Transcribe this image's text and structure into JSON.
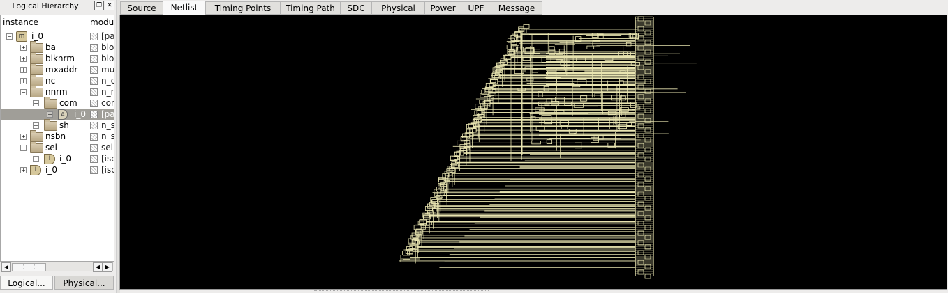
{
  "left_panel": {
    "title": "Logical Hierarchy",
    "float_icon": "restore-icon",
    "close_icon": "close-icon",
    "columns": [
      "instance",
      "modu"
    ],
    "tree": [
      {
        "label": "i_0",
        "module": "[pa",
        "icon": "module-icon",
        "expander": "−",
        "level": 0
      },
      {
        "label": "ba",
        "module": "blo",
        "icon": "folder-icon",
        "expander": "+",
        "level": 1
      },
      {
        "label": "blknrm",
        "module": "blo",
        "icon": "folder-icon",
        "expander": "+",
        "level": 1
      },
      {
        "label": "mxaddr",
        "module": "mu",
        "icon": "folder-icon",
        "expander": "+",
        "level": 1
      },
      {
        "label": "nc",
        "module": "n_c",
        "icon": "folder-icon",
        "expander": "+",
        "level": 1
      },
      {
        "label": "nnrm",
        "module": "n_r",
        "icon": "folder-icon",
        "expander": "−",
        "level": 1
      },
      {
        "label": "com",
        "module": "cor",
        "icon": "folder-icon",
        "expander": "−",
        "level": 2
      },
      {
        "label": "i_0",
        "module": "[pa",
        "icon": "and-gate-icon",
        "expander": "+",
        "level": 3,
        "selected": true
      },
      {
        "label": "sh",
        "module": "n_s",
        "icon": "folder-icon",
        "expander": "+",
        "level": 2
      },
      {
        "label": "nsbn",
        "module": "n_s",
        "icon": "folder-icon",
        "expander": "+",
        "level": 1
      },
      {
        "label": "sel",
        "module": "sel",
        "icon": "folder-icon",
        "expander": "−",
        "level": 1
      },
      {
        "label": "i_0",
        "module": "[isc",
        "icon": "instance-icon",
        "expander": "+",
        "level": 2
      },
      {
        "label": "i_0",
        "module": "[isc",
        "icon": "instance-icon",
        "expander": "+",
        "level": 1
      }
    ],
    "bottom_tabs": [
      "Logical...",
      "Physical..."
    ]
  },
  "tabs": [
    {
      "label": "Source",
      "active": false
    },
    {
      "label": "Netlist",
      "active": true
    },
    {
      "label": "Timing Points",
      "active": false
    },
    {
      "label": "Timing Path",
      "active": false
    },
    {
      "label": "SDC",
      "active": false
    },
    {
      "label": "Physical",
      "active": false
    },
    {
      "label": "Power",
      "active": false
    },
    {
      "label": "UPF",
      "active": false
    },
    {
      "label": "Message",
      "active": false
    }
  ],
  "colors": {
    "canvas_bg": "#000000",
    "wire": "#e8e4b0",
    "selection": "#a09e98"
  }
}
